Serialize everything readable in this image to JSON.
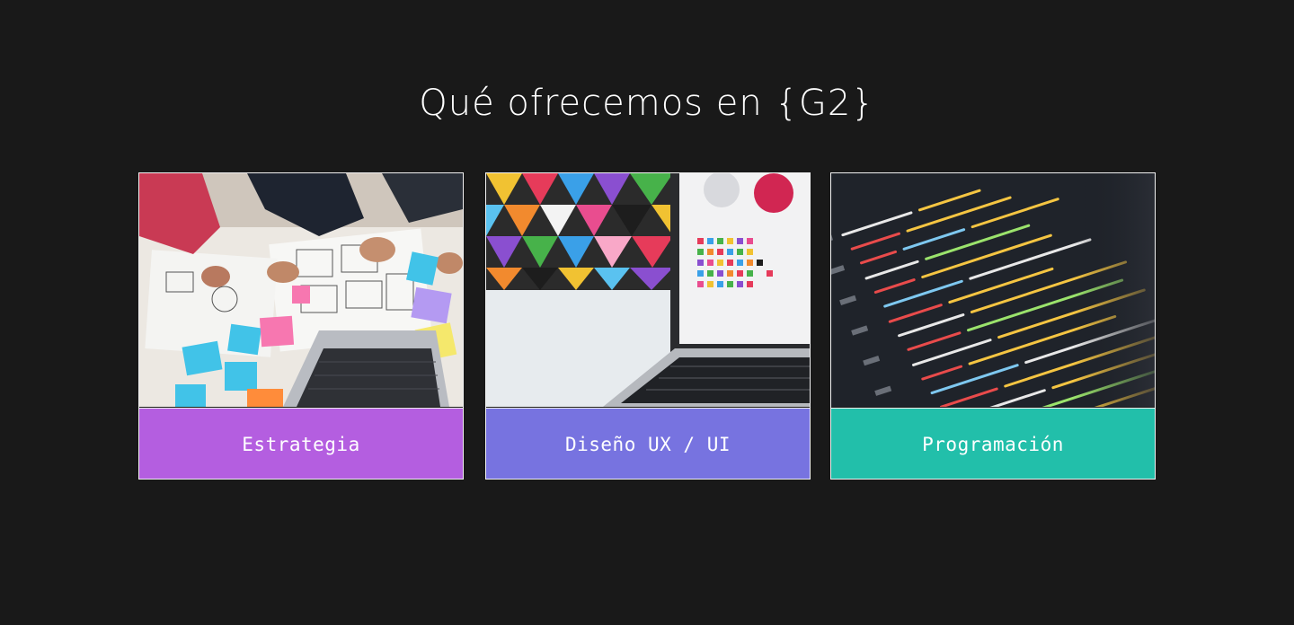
{
  "section": {
    "title": "Qué ofrecemos en {G2}"
  },
  "services": [
    {
      "label": "Estrategia",
      "color": "#b45ee0",
      "image_icon": "brainstorm-desk-photo"
    },
    {
      "label": "Diseño UX / UI",
      "color": "#7773e0",
      "image_icon": "laptop-design-photo"
    },
    {
      "label": "Programación",
      "color": "#22bfaa",
      "image_icon": "code-screen-photo"
    }
  ]
}
